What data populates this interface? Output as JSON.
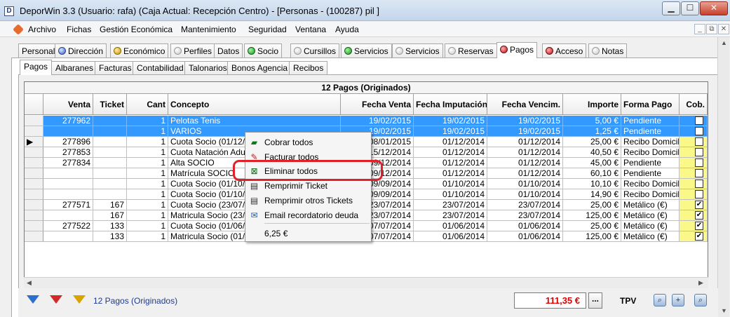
{
  "window": {
    "title": "DeporWin 3.3  (Usuario: rafa)  (Caja Actual: Recepción Centro) - [Personas - (100287) pil ]",
    "icon_letter": "D"
  },
  "menu": [
    "Archivo",
    "Fichas",
    "Gestión Económica",
    "Mantenimiento",
    "Seguridad",
    "Ventana",
    "Ayuda"
  ],
  "main_tabs": [
    {
      "label": "Personal",
      "dot": ""
    },
    {
      "label": "Dirección",
      "dot": "blue"
    },
    {
      "label": "Económico",
      "dot": "gold"
    },
    {
      "label": "Perfiles",
      "dot": "gray"
    },
    {
      "label": "Datos",
      "dot": ""
    },
    {
      "label": "Socio",
      "dot": "green"
    },
    {
      "label": "Cursillos",
      "dot": "gray"
    },
    {
      "label": "Servicios",
      "dot": "green"
    },
    {
      "label": "Servicios",
      "dot": "gray"
    },
    {
      "label": "Reservas",
      "dot": "gray"
    },
    {
      "label": "Pagos",
      "dot": "red",
      "active": true
    },
    {
      "label": "Acceso",
      "dot": "red"
    },
    {
      "label": "Notas",
      "dot": "gray"
    }
  ],
  "sub_tabs": [
    {
      "label": "Pagos",
      "active": true
    },
    {
      "label": "Albaranes"
    },
    {
      "label": "Facturas"
    },
    {
      "label": "Contabilidad"
    },
    {
      "label": "Talonarios"
    },
    {
      "label": "Bonos Agencia"
    },
    {
      "label": "Recibos"
    }
  ],
  "grid": {
    "caption": "12 Pagos (Originados)",
    "columns": [
      "Venta",
      "Ticket",
      "Cant",
      "Concepto",
      "Fecha Venta",
      "Fecha Imputación",
      "Fecha Vencim.",
      "Importe",
      "Forma Pago",
      "Cob."
    ],
    "rows": [
      {
        "indicator": "",
        "venta": "277962",
        "ticket": "",
        "cant": "1",
        "concepto": "Pelotas Tenis",
        "fecha_venta": "19/02/2015",
        "fecha_imputacion": "19/02/2015",
        "fecha_vencim": "19/02/2015",
        "importe": "5,00 €",
        "forma_pago": "Pendiente",
        "cob": "",
        "selected": true
      },
      {
        "indicator": "",
        "venta": "",
        "ticket": "",
        "cant": "1",
        "concepto": "VARIOS",
        "fecha_venta": "19/02/2015",
        "fecha_imputacion": "19/02/2015",
        "fecha_vencim": "19/02/2015",
        "importe": "1,25 €",
        "forma_pago": "Pendiente",
        "cob": "",
        "selected": true
      },
      {
        "indicator": "▶",
        "venta": "277896",
        "ticket": "",
        "cant": "1",
        "concepto": "Cuota Socio (01/12/20",
        "fecha_venta": "08/01/2015",
        "fecha_imputacion": "01/12/2014",
        "fecha_vencim": "01/12/2014",
        "importe": "25,00 €",
        "forma_pago": "Recibo Domicilia",
        "cob": ""
      },
      {
        "indicator": "",
        "venta": "277853",
        "ticket": "",
        "cant": "1",
        "concepto": "Cuota Natación Adulto",
        "fecha_venta": "15/12/2014",
        "fecha_imputacion": "01/12/2014",
        "fecha_vencim": "01/12/2014",
        "importe": "40,50 €",
        "forma_pago": "Recibo Domicilia",
        "cob": ""
      },
      {
        "indicator": "",
        "venta": "277834",
        "ticket": "",
        "cant": "1",
        "concepto": "Alta SOCIO",
        "fecha_venta": "09/12/2014",
        "fecha_imputacion": "01/12/2014",
        "fecha_vencim": "01/12/2014",
        "importe": "45,00 €",
        "forma_pago": "Pendiente",
        "cob": ""
      },
      {
        "indicator": "",
        "venta": "",
        "ticket": "",
        "cant": "1",
        "concepto": "Matrícula SOCIO",
        "fecha_venta": "09/12/2014",
        "fecha_imputacion": "01/12/2014",
        "fecha_vencim": "01/12/2014",
        "importe": "60,10 €",
        "forma_pago": "Pendiente",
        "cob": ""
      },
      {
        "indicator": "",
        "venta": "",
        "ticket": "",
        "cant": "1",
        "concepto": "Cuota Socio (01/10/20",
        "fecha_venta": "09/09/2014",
        "fecha_imputacion": "01/10/2014",
        "fecha_vencim": "01/10/2014",
        "importe": "10,10 €",
        "forma_pago": "Recibo Domicilia",
        "cob": ""
      },
      {
        "indicator": "",
        "venta": "",
        "ticket": "",
        "cant": "1",
        "concepto": "Cuota Socio (01/10/20",
        "fecha_venta": "09/09/2014",
        "fecha_imputacion": "01/10/2014",
        "fecha_vencim": "01/10/2014",
        "importe": "14,90 €",
        "forma_pago": "Recibo Domicilia",
        "cob": ""
      },
      {
        "indicator": "",
        "venta": "277571",
        "ticket": "167",
        "cant": "1",
        "concepto": "Cuota Socio (23/07/20",
        "fecha_venta": "23/07/2014",
        "fecha_imputacion": "23/07/2014",
        "fecha_vencim": "23/07/2014",
        "importe": "25,00 €",
        "forma_pago": "Metálico (€)",
        "cob": "✔"
      },
      {
        "indicator": "",
        "venta": "",
        "ticket": "167",
        "cant": "1",
        "concepto": "Matricula Socio (23/07",
        "fecha_venta": "23/07/2014",
        "fecha_imputacion": "23/07/2014",
        "fecha_vencim": "23/07/2014",
        "importe": "125,00 €",
        "forma_pago": "Metálico (€)",
        "cob": "✔"
      },
      {
        "indicator": "",
        "venta": "277522",
        "ticket": "133",
        "cant": "1",
        "concepto": "Cuota Socio (01/06/20",
        "fecha_venta": "07/07/2014",
        "fecha_imputacion": "01/06/2014",
        "fecha_vencim": "01/06/2014",
        "importe": "25,00 €",
        "forma_pago": "Metálico (€)",
        "cob": "✔"
      },
      {
        "indicator": "",
        "venta": "",
        "ticket": "133",
        "cant": "1",
        "concepto": "Matricula Socio (01/06",
        "fecha_venta": "07/07/2014",
        "fecha_imputacion": "01/06/2014",
        "fecha_vencim": "01/06/2014",
        "importe": "125,00 €",
        "forma_pago": "Metálico (€)",
        "cob": "✔"
      }
    ]
  },
  "context_menu": {
    "items": [
      {
        "label": "Cobrar todos",
        "icon": "cash-register-icon"
      },
      {
        "label": "Facturar todos",
        "icon": "invoice-icon"
      },
      {
        "label": "Eliminar todos",
        "icon": "delete-all-icon",
        "highlighted": true
      },
      {
        "label": "Remprimir Ticket",
        "icon": "printer-icon"
      },
      {
        "label": "Remprimir otros Tickets",
        "icon": "printer-icon"
      },
      {
        "label": "Email recordatorio deuda",
        "icon": "email-icon"
      }
    ],
    "total": "6,25 €"
  },
  "status": {
    "label": "12 Pagos (Originados)",
    "total": "111,35 €",
    "dots_button": "...",
    "tpv": "TPV"
  },
  "colors": {
    "selection": "#3399ff",
    "highlight_border": "#e0202a",
    "cob_column": "#fbf88a",
    "total_text": "#dd0000"
  }
}
